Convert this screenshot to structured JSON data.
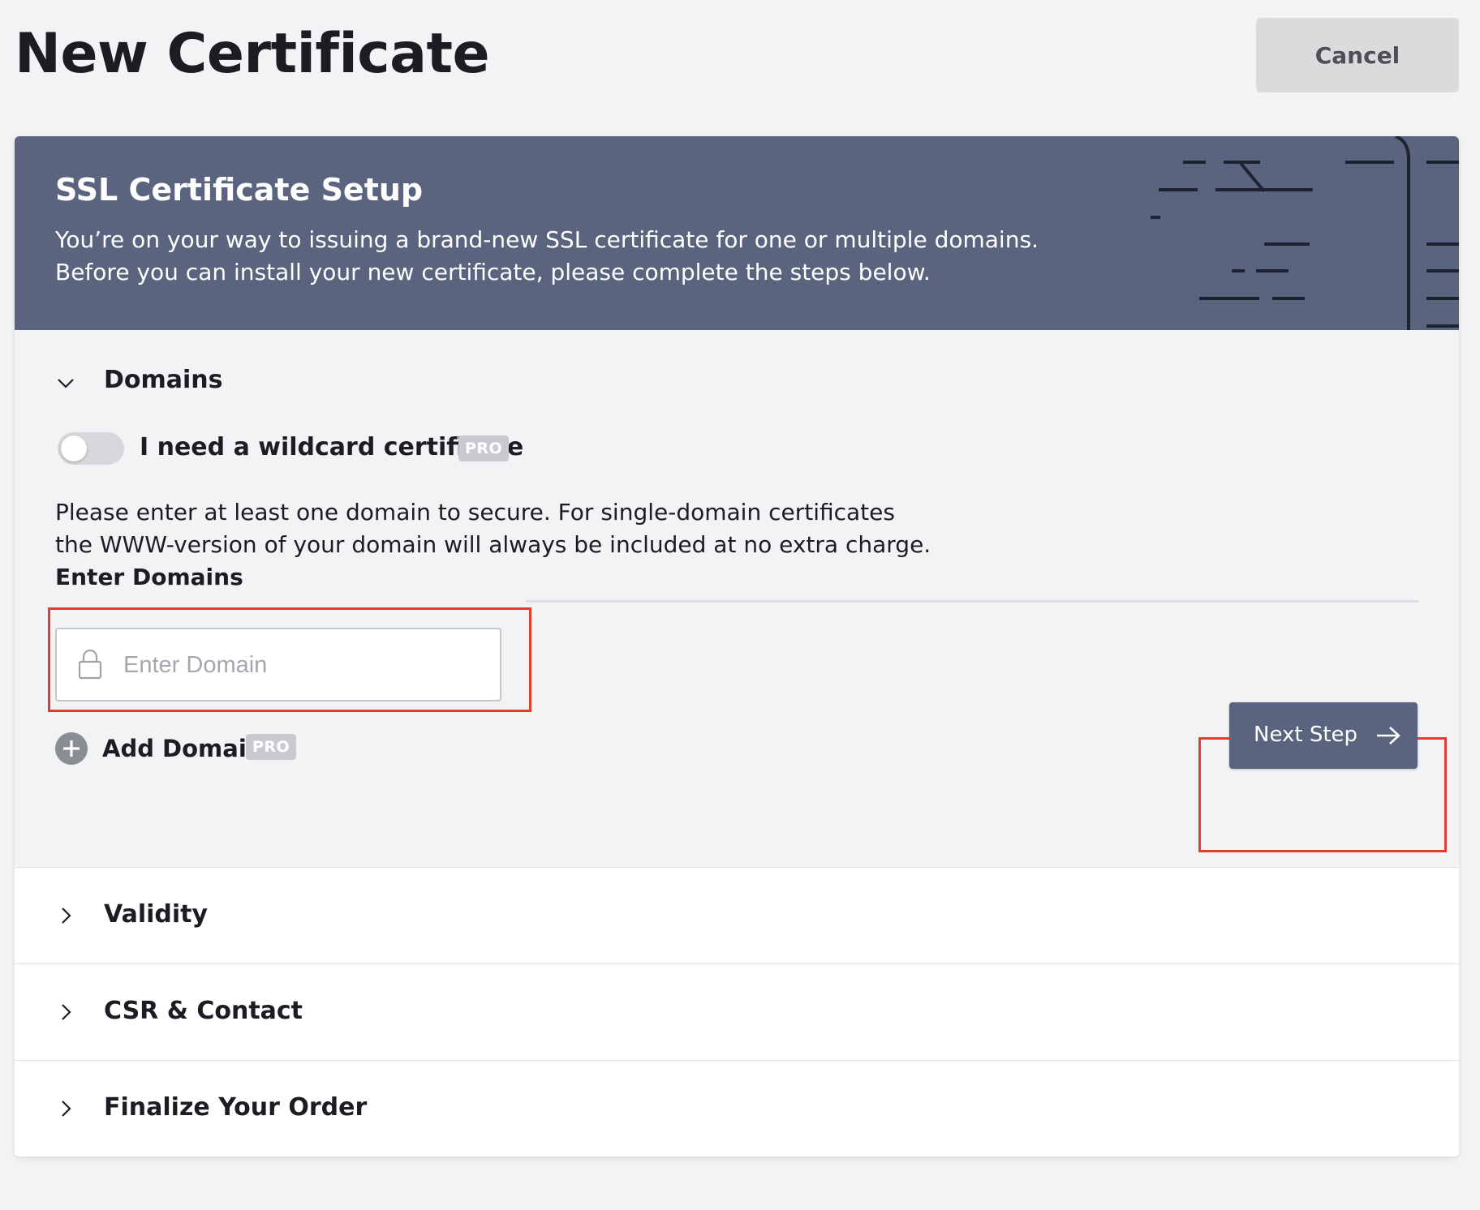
{
  "header": {
    "title": "New Certificate",
    "cancel_label": "Cancel"
  },
  "banner": {
    "title": "SSL Certificate Setup",
    "line1": "You’re on your way to issuing a brand-new SSL certificate for one or multiple domains.",
    "line2": "Before you can install your new certificate, please complete the steps below."
  },
  "domains": {
    "section_title": "Domains",
    "wildcard_label": "I need a wildcard certificate",
    "wildcard_enabled": false,
    "pro_badge": "PRO",
    "info_line1": "Please enter at least one domain to secure. For single-domain certificates",
    "info_line2": "the WWW-version of your domain will always be included at no extra charge.",
    "enter_label": "Enter Domains",
    "input_placeholder": "Enter Domain",
    "input_value": "",
    "add_domain_label": "Add Domain",
    "next_step_label": "Next Step"
  },
  "sections": [
    {
      "title": "Validity"
    },
    {
      "title": "CSR & Contact"
    },
    {
      "title": "Finalize Your Order"
    }
  ],
  "colors": {
    "banner": "#5b647e",
    "highlight": "#e0412f",
    "background": "#f2f3f4"
  },
  "icons": [
    "chevron-down-icon",
    "chevron-right-icon",
    "lock-icon",
    "plus-circle-icon",
    "arrow-right-icon"
  ]
}
